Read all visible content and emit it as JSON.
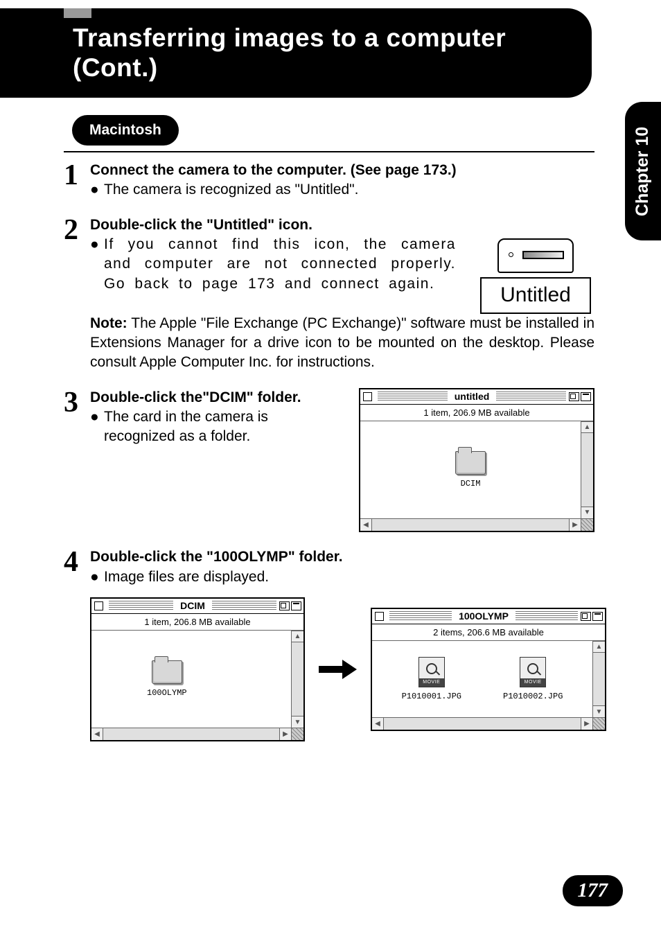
{
  "header": {
    "title_line1": "Transferring images to a computer",
    "title_line2": "(Cont.)"
  },
  "side_tab": "Chapter 10",
  "section_label": "Macintosh",
  "steps": {
    "s1": {
      "num": "1",
      "title": "Connect the camera to the computer. (See page 173.)",
      "bullet": "The camera is recognized as \"Untitled\"."
    },
    "s2": {
      "num": "2",
      "title": "Double-click the \"Untitled\" icon.",
      "bullet": "If you cannot find this icon, the camera and computer are not connected properly. Go back to page 173 and connect again.",
      "note_label": "Note:",
      "note_body": " The Apple \"File Exchange (PC Exchange)\" software must be installed in Extensions Manager for a drive icon to be mounted on the desktop. Please consult Apple Computer Inc. for instructions.",
      "drive_label": "Untitled"
    },
    "s3": {
      "num": "3",
      "title": "Double-click the\"DCIM\" folder.",
      "bullet": "The card in the camera is recognized as a folder.",
      "win": {
        "title": "untitled",
        "status": "1 item, 206.9 MB available",
        "folder": "DCIM"
      }
    },
    "s4": {
      "num": "4",
      "title": "Double-click the \"100OLYMP\" folder.",
      "bullet": "Image files are displayed.",
      "win_left": {
        "title": "DCIM",
        "status": "1 item, 206.8 MB available",
        "folder": "100OLYMP"
      },
      "win_right": {
        "title": "100OLYMP",
        "status": "2 items, 206.6 MB available",
        "file1": "P1010001.JPG",
        "file2": "P1010002.JPG",
        "file_type": "MOVIE"
      }
    }
  },
  "page_number": "177"
}
